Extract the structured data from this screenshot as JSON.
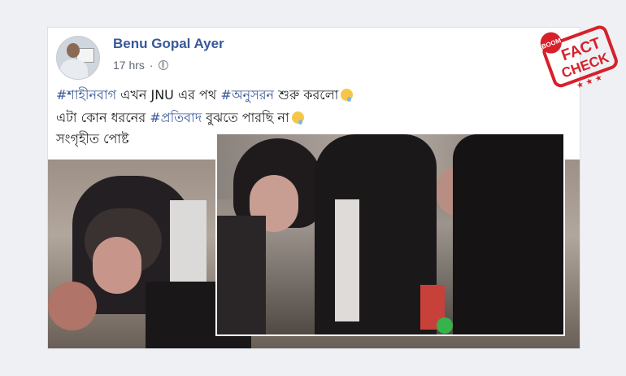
{
  "post": {
    "author": "Benu Gopal Ayer",
    "time": "17 hrs",
    "line1": {
      "tag1": "#শাহীনবাগ",
      "text1": " এখন JNU এর পথ ",
      "tag2": "#অনুসরন",
      "text2": " শুরু করলো"
    },
    "line2": {
      "text1": "এটা কোন ধরনের ",
      "tag": "#প্রতিবাদ",
      "text2": " বুঝতে পারছি না"
    },
    "line3": "সংগৃহীত পোষ্ট"
  },
  "stamp": {
    "brand": "BOOM",
    "word1": "FACT",
    "word2": "CHECK"
  },
  "colors": {
    "link": "#385898",
    "stamp_red": "#d8202a"
  },
  "icons": [
    "globe-icon",
    "sad-face-emoji"
  ]
}
